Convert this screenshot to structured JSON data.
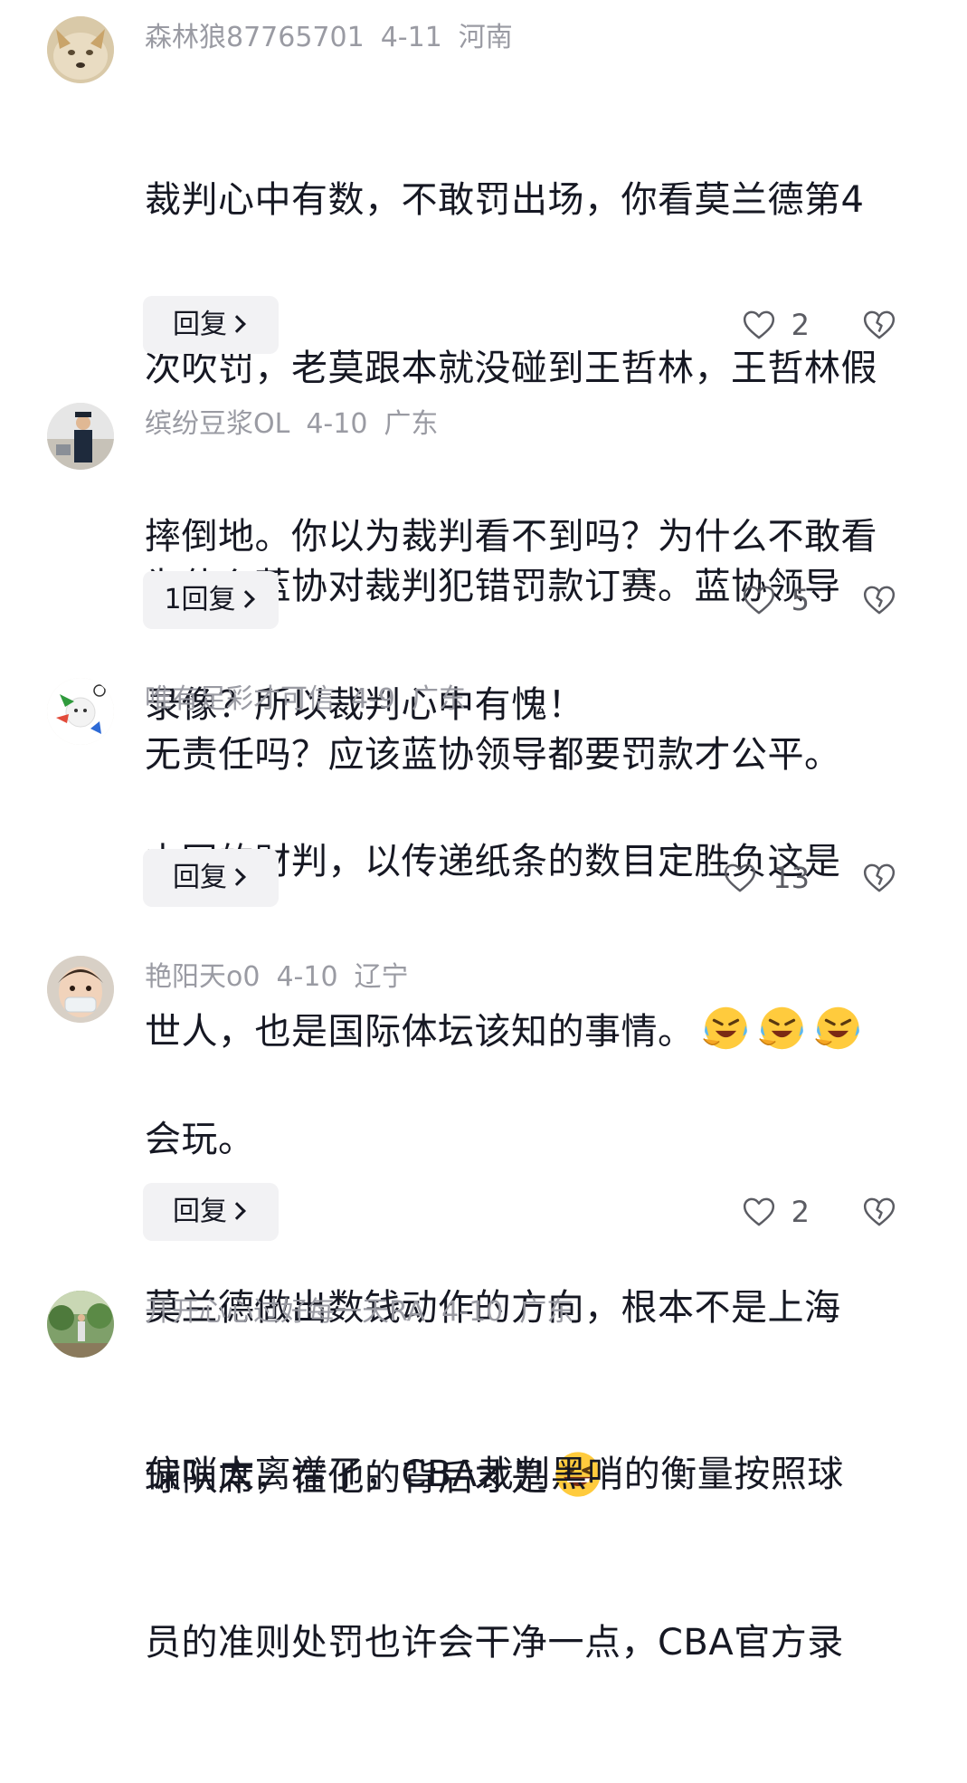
{
  "comments": [
    {
      "user": "森林狼87765701",
      "date": "4-11",
      "location": "河南",
      "lines": [
        "裁判心中有数，不敢罚出场，你看莫兰德第4",
        "次吹罚，老莫跟本就没碰到王哲林，王哲林假",
        "摔倒地。你以为裁判看不到吗？为什么不敢看",
        "录像？所以裁判心中有愧！"
      ],
      "reply_label": "回复",
      "likes": "2"
    },
    {
      "user": "缤纷豆浆OL",
      "date": "4-10",
      "location": "广东",
      "lines": [
        "为什么蓝协对裁判犯错罚款订赛。蓝协领导",
        "无责任吗？应该蓝协领导都要罚款才公平。"
      ],
      "reply_label": "1回复",
      "likes": "5"
    },
    {
      "user": "唯有足彩才可信",
      "date": "4-9",
      "location": "广东",
      "lines": [
        "中国的财判，以传递纸条的数目定胜负这是",
        "世人，也是国际体坛该知的事情。"
      ],
      "emoji": "laughing-crying-emoji",
      "reply_label": "回复",
      "likes": "13"
    },
    {
      "user": "艳阳天o0",
      "date": "4-10",
      "location": "辽宁",
      "lines": [
        "会玩。",
        "莫兰德做出数钱动作的方向，根本不是上海",
        "球队席，在他的背后才是"
      ],
      "emoji": "grinning-emoji",
      "reply_label": "回复",
      "likes": "2"
    },
    {
      "user": "开开心心过好每一天RA",
      "date": "4-10",
      "location": "广东",
      "lines": [
        "偏哨太离谱了，CBA裁判黑哨的衡量按照球",
        "员的准则处罚也许会干净一点，CBA官方录"
      ]
    }
  ],
  "icons": {
    "like": "heart-outline-icon",
    "dislike": "broken-heart-icon",
    "chevron": "chevron-right-icon"
  },
  "colors": {
    "meta_text": "#9a9ba3",
    "body_text": "#161823",
    "reply_bg": "#f2f2f4"
  }
}
